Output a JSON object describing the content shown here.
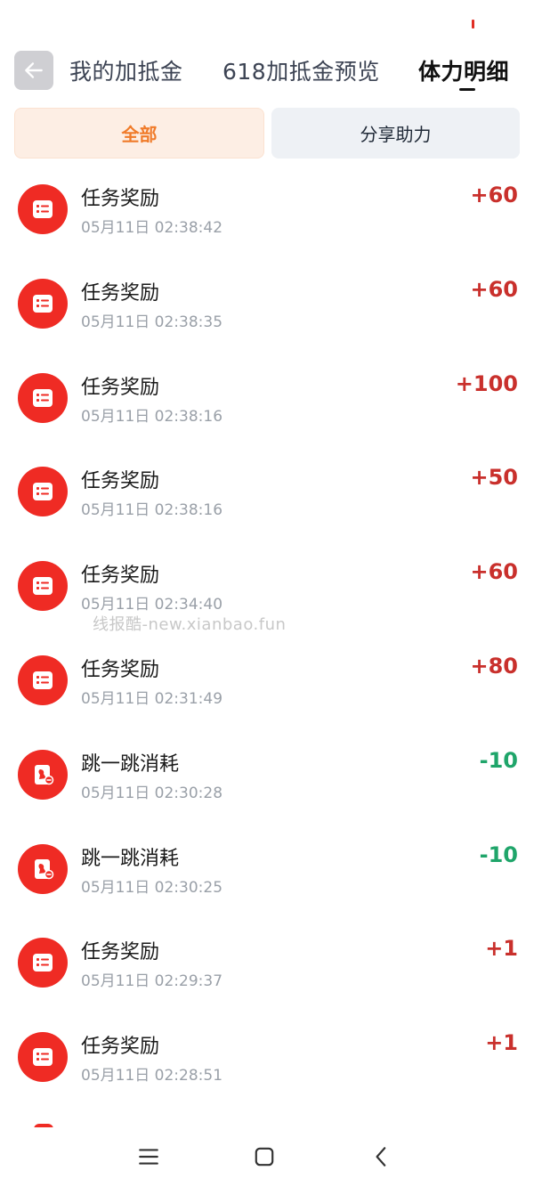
{
  "header": {
    "back_icon": "arrow-left-icon",
    "tabs": [
      {
        "label": "我的加抵金"
      },
      {
        "label": "618加抵金预览"
      },
      {
        "label": "体力明细"
      }
    ],
    "active_tab": 2
  },
  "filters": [
    {
      "label": "全部"
    },
    {
      "label": "分享助力"
    }
  ],
  "colors": {
    "accent_red": "#ef2b24",
    "positive": "#c9302c",
    "negative": "#1fa56a",
    "filter_active": "#f07b2a"
  },
  "records": [
    {
      "title": "任务奖励",
      "time": "05月11日 02:38:42",
      "amount": "+60",
      "icon": "task-list-icon"
    },
    {
      "title": "任务奖励",
      "time": "05月11日 02:38:35",
      "amount": "+60",
      "icon": "task-list-icon"
    },
    {
      "title": "任务奖励",
      "time": "05月11日 02:38:16",
      "amount": "+100",
      "icon": "task-list-icon"
    },
    {
      "title": "任务奖励",
      "time": "05月11日 02:38:16",
      "amount": "+50",
      "icon": "task-list-icon"
    },
    {
      "title": "任务奖励",
      "time": "05月11日 02:34:40",
      "amount": "+60",
      "icon": "task-list-icon"
    },
    {
      "title": "任务奖励",
      "time": "05月11日 02:31:49",
      "amount": "+80",
      "icon": "task-list-icon"
    },
    {
      "title": "跳一跳消耗",
      "time": "05月11日 02:30:28",
      "amount": "-10",
      "icon": "jump-consume-icon"
    },
    {
      "title": "跳一跳消耗",
      "time": "05月11日 02:30:25",
      "amount": "-10",
      "icon": "jump-consume-icon"
    },
    {
      "title": "任务奖励",
      "time": "05月11日 02:29:37",
      "amount": "+1",
      "icon": "task-list-icon"
    },
    {
      "title": "任务奖励",
      "time": "05月11日 02:28:51",
      "amount": "+1",
      "icon": "task-list-icon"
    }
  ],
  "watermark": "线报酷-new.xianbao.fun",
  "navbar": {
    "menu_icon": "menu-icon",
    "home_icon": "home-square-icon",
    "back_icon": "back-chevron-icon"
  }
}
